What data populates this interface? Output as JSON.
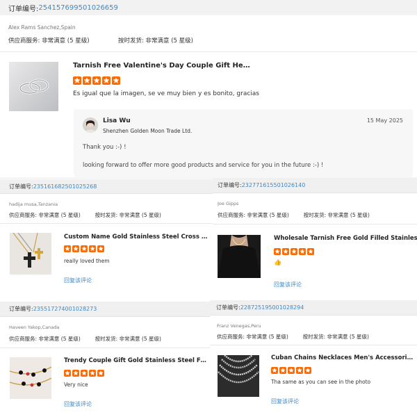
{
  "order_label": "订单编号:",
  "supplier_label": "供应商服务:",
  "shipping_label": "按时发货:",
  "reply_link_label": "回复该评论",
  "reviews": [
    {
      "order_no": "254157699501026659",
      "buyer": "Alex Rams Sanchez,Spain",
      "supplier_value": "非常满意 (5 星级)",
      "shipping_value": "非常满意 (5 星级)",
      "product_title": "Tarnish Free Valentine's Day Couple Gift Heart ...",
      "stars": 5,
      "review_text": "Es igual que la imagen, se ve muy bien y es bonito, gracias",
      "seller_reply": {
        "name": "Lisa Wu",
        "company": "Shenzhen Golden Moon Trade Ltd.",
        "date": "15 May 2025",
        "line1": "Thank you :-) !",
        "line2": "looking forward to offer more good products and service for you in the future :-) !"
      }
    },
    {
      "order_no": "235161682501025268",
      "buyer": "hadija musa,Tanzania",
      "supplier_value": "非常满意 (5 星级)",
      "shipping_value": "非常满意 (5 星级)",
      "product_title": "Custom Name Gold Stainless Steel Cross Pend...",
      "stars": 5,
      "review_text": "really loved them"
    },
    {
      "order_no": "232771615501026140",
      "buyer": "Joe Gipps",
      "supplier_value": "非常满意 (5 星级)",
      "shipping_value": "非常满意 (5 星级)",
      "product_title": "Wholesale Tarnish Free Gold Filled Stainless S",
      "stars": 5,
      "review_text": "👍"
    },
    {
      "order_no": "235517274001028273",
      "buyer": "Haveen Yakop,Canada",
      "supplier_value": "非常满意 (5 星级)",
      "shipping_value": "非常满意 (5 星级)",
      "product_title": "Trendy Couple Gift Gold Stainless Steel Four Leaf Clo...",
      "stars": 5,
      "review_text": "Very nice"
    },
    {
      "order_no": "228725195001028294",
      "buyer": "Franz Venegas,Peru",
      "supplier_value": "非常满意 (5 星级)",
      "shipping_value": "非常满意 (5 星级)",
      "product_title": "Cuban Chains Necklaces Men's Accessories Fa...",
      "stars": 5,
      "review_text": "Tha same as you can see in the photo"
    }
  ],
  "colors": {
    "star": "#ff6a00",
    "link": "#3f88c5"
  }
}
